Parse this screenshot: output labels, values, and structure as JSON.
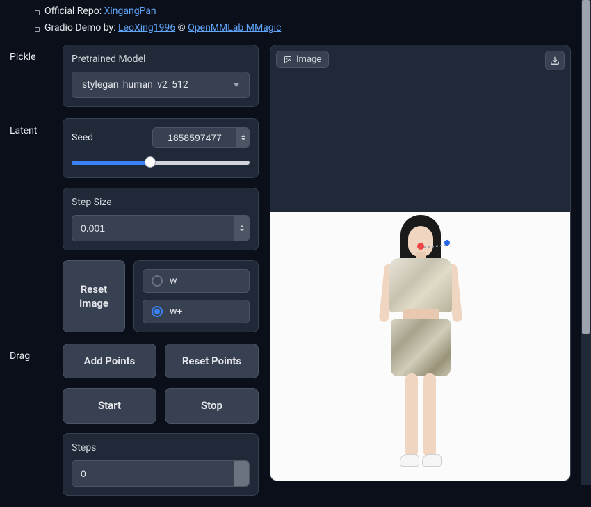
{
  "header": {
    "repo_prefix": "Official Repo: ",
    "repo_link": "XingangPan",
    "demo_prefix": "Gradio Demo by: ",
    "demo_link": "LeoXing1996",
    "copyright": " © ",
    "org_link": "OpenMMLab MMagic"
  },
  "sections": {
    "pickle": "Pickle",
    "latent": "Latent",
    "drag": "Drag"
  },
  "pickle": {
    "label": "Pretrained Model",
    "selected": "stylegan_human_v2_512"
  },
  "latent": {
    "seed_label": "Seed",
    "seed_value": "1858597477",
    "step_label": "Step Size",
    "step_value": "0.001"
  },
  "buttons": {
    "reset_image": "Reset Image",
    "add_points": "Add Points",
    "reset_points": "Reset Points",
    "start": "Start",
    "stop": "Stop"
  },
  "radio": {
    "w": "w",
    "wplus": "w+"
  },
  "steps": {
    "label": "Steps",
    "value": "0"
  },
  "image": {
    "tag": "Image"
  }
}
